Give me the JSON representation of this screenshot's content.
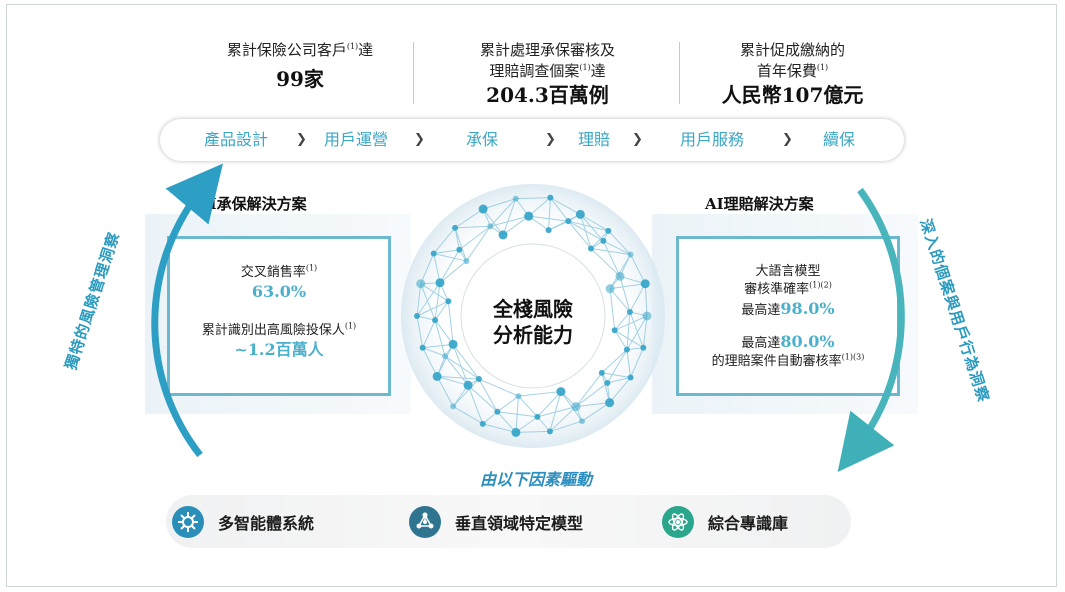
{
  "stats": [
    {
      "line1": "累計保險公司客戶",
      "sup1": "(1)",
      "line1b": "達",
      "line2": "",
      "sup2": "",
      "line2b": "",
      "value": "99家"
    },
    {
      "line1": "累計處理承保審核及",
      "sup1": "",
      "line1b": "",
      "line2": "理賠調查個案",
      "sup2": "(1)",
      "line2b": "達",
      "value": "204.3百萬例"
    },
    {
      "line1": "累計促成繳納的",
      "sup1": "",
      "line1b": "",
      "line2": "首年保費",
      "sup2": "(1)",
      "line2b": "",
      "value": "人民幣107億元"
    }
  ],
  "process_steps": [
    "產品設計",
    "用戶運營",
    "承保",
    "理賠",
    "用戶服務",
    "續保"
  ],
  "left_panel": {
    "title": "AI承保解決方案",
    "item1_label": "交叉銷售率",
    "item1_sup": "(1)",
    "item1_value": "63.0%",
    "item2_label": "累計識別出高風險投保人",
    "item2_sup": "(1)",
    "item2_value": "~1.2百萬人"
  },
  "right_panel": {
    "title": "AI理賠解決方案",
    "line1": "大語言模型",
    "line2": "審核準確率",
    "line2_sup": "(1)(2)",
    "line3_prefix": "最高達",
    "line3_value": "98.0%",
    "line4_prefix": "最高達",
    "line4_value": "80.0%",
    "line5": "的理賠案件自動審核率",
    "line5_sup": "(1)(3)"
  },
  "center_label": [
    "全棧風險",
    "分析能力"
  ],
  "left_arc_label": "獨特的風險管理洞察",
  "right_arc_label": "深入的個案與用戶行為洞察",
  "driven_by": "由以下因素驅動",
  "drivers": [
    {
      "label": "多智能體系統",
      "icon": "gear-network-icon",
      "color": "#2a8fb8"
    },
    {
      "label": "垂直領域特定模型",
      "icon": "molecule-network-icon",
      "color": "#2f7590"
    },
    {
      "label": "綜合專識庫",
      "icon": "atom-knowledge-icon",
      "color": "#2aa68c"
    }
  ],
  "colors": {
    "accent": "#3ba7c4",
    "value": "#4bb0cc",
    "arc": "#3aa6c4"
  }
}
